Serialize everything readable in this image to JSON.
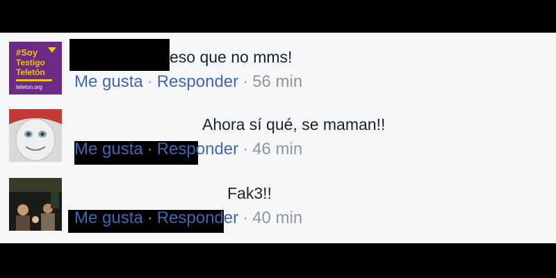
{
  "comments": [
    {
      "avatar_icon": "soy-testigo-teleton-avatar",
      "avatar_text": {
        "line1": "#Soy",
        "line2": "Testigo",
        "line3": "Teletón",
        "url": "teleton.org"
      },
      "text": "eso que no mms!",
      "like_label": "Me gusta",
      "reply_label": "Responder",
      "separator": "·",
      "time": "56 min"
    },
    {
      "avatar_icon": "cartoon-face-avatar",
      "text": "Ahora sí qué, se maman!!",
      "like_label": "Me gusta",
      "reply_label": "Responder",
      "separator": "·",
      "time": "46 min"
    },
    {
      "avatar_icon": "people-photo-avatar",
      "text": "Fak3!!",
      "like_label": "Me gusta",
      "reply_label": "Responder",
      "separator": "·",
      "time": "40 min"
    }
  ],
  "colors": {
    "link": "#4267b2",
    "meta": "#90949c",
    "text": "#1d2129",
    "panel_bg": "#f6f7f9",
    "avatar1_bg": "#6b2a84",
    "avatar1_accent": "#f5c400"
  }
}
